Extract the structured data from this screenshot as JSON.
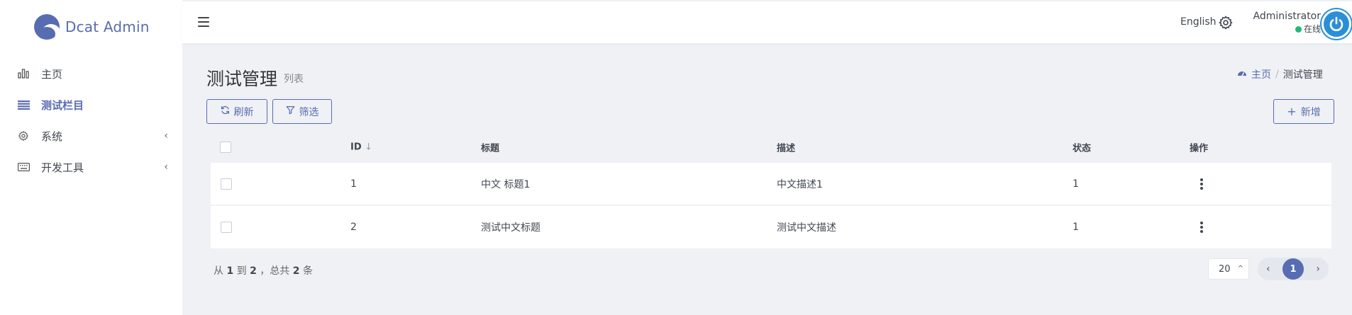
{
  "brand": {
    "name": "Dcat Admin"
  },
  "sidebar": {
    "items": [
      {
        "label": "主页",
        "icon": "bar-chart-icon"
      },
      {
        "label": "测试栏目",
        "icon": "list-icon",
        "active": true
      },
      {
        "label": "系统",
        "icon": "gear-icon",
        "has_children": true
      },
      {
        "label": "开发工具",
        "icon": "keyboard-icon",
        "has_children": true
      }
    ]
  },
  "header": {
    "language": "English",
    "user_name": "Administrator",
    "user_status": "在线"
  },
  "page": {
    "title": "测试管理",
    "subtitle": "列表",
    "breadcrumb": {
      "home": "主页",
      "current": "测试管理"
    }
  },
  "toolbar": {
    "refresh_label": "刷新",
    "filter_label": "筛选",
    "new_label": "新增"
  },
  "table": {
    "columns": [
      "ID",
      "标题",
      "描述",
      "状态",
      "操作"
    ],
    "rows": [
      {
        "id": "1",
        "title": "中文 标题1",
        "desc": "中文描述1",
        "status": "1"
      },
      {
        "id": "2",
        "title": "测试中文标题",
        "desc": "测试中文描述",
        "status": "1"
      }
    ]
  },
  "footer": {
    "summary_from": "1",
    "summary_to": "2",
    "summary_total": "2",
    "per_page": "20",
    "current_page": "1"
  },
  "colors": {
    "accent": "#586cb1",
    "online": "#21b978",
    "avatar": "#2b8fd6"
  }
}
